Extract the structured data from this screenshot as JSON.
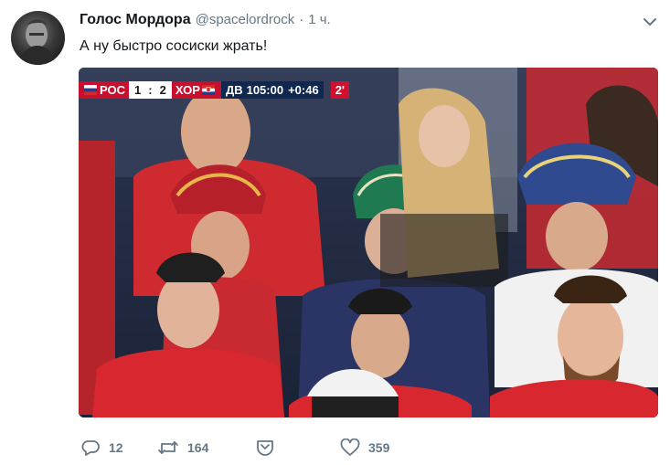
{
  "tweet": {
    "author": {
      "display_name": "Голос Мордора",
      "handle": "@spacelordrock"
    },
    "separator": "·",
    "timestamp": "1 ч.",
    "text": "А ну быстро сосиски жрать!",
    "menu_icon": "chevron-down-icon"
  },
  "media": {
    "scoreboard": {
      "team1": "РОС",
      "score1": "1",
      "separator": ":",
      "score2": "2",
      "team2": "ХОР",
      "period": "ДВ",
      "clock": "105:00",
      "added": "+0:46",
      "extra": "2'"
    }
  },
  "actions": {
    "reply": {
      "icon": "reply-icon",
      "count": "12"
    },
    "retweet": {
      "icon": "retweet-icon",
      "count": "164"
    },
    "dm": {
      "icon": "direct-message-icon"
    },
    "like": {
      "icon": "heart-icon",
      "count": "359"
    }
  },
  "colors": {
    "secondary_text": "#657786",
    "primary_text": "#14171a",
    "russia_red": "#c8102e"
  }
}
